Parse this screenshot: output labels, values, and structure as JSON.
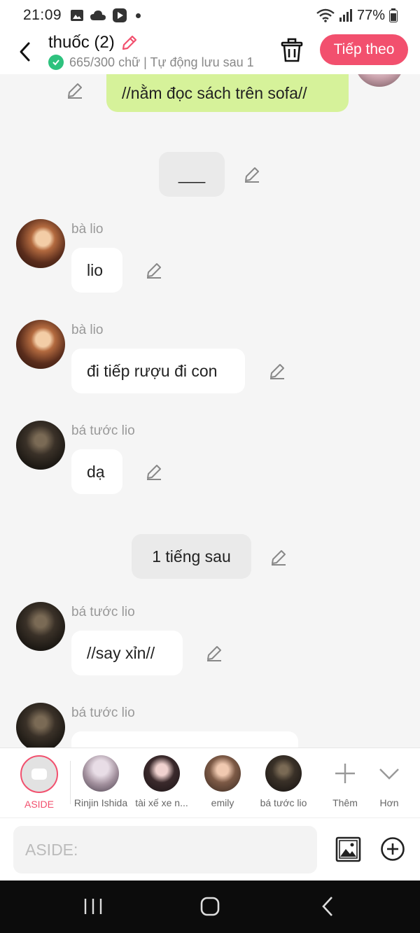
{
  "status": {
    "time": "21:09",
    "battery": "77%"
  },
  "header": {
    "title": "thuốc (2)",
    "subtitle": "665/300 chữ | Tự động lưu sau 1",
    "next_label": "Tiếp theo"
  },
  "messages": {
    "m1": {
      "text": "//nằm đọc sách trên sofa//"
    },
    "n1": {
      "text": "___"
    },
    "m2": {
      "sender": "bà lio",
      "text": "lio"
    },
    "m3": {
      "sender": "bà lio",
      "text": "đi tiếp rượu đi con"
    },
    "m4": {
      "sender": "bá tước lio",
      "text": "dạ"
    },
    "n2": {
      "text": "1 tiếng sau"
    },
    "m5": {
      "sender": "bá tước lio",
      "text": "//say xỉn//"
    },
    "m6": {
      "sender": "bá tước lio",
      "text": ""
    }
  },
  "characters": [
    {
      "label": "ASIDE"
    },
    {
      "label": "Rinjin Ishida"
    },
    {
      "label": "tài xế xe n..."
    },
    {
      "label": "emily"
    },
    {
      "label": "bá tước lio"
    },
    {
      "label": "Thêm"
    },
    {
      "label": "Hơn"
    }
  ],
  "input": {
    "placeholder": "ASIDE:"
  },
  "colors": {
    "accent": "#f2506e",
    "my_bubble": "#d6f29a",
    "saved_check": "#2ec27e"
  },
  "icons": [
    "back-arrow-icon",
    "pencil-icon",
    "trash-icon",
    "image-icon",
    "plus-circle-icon",
    "recents-icon",
    "home-icon",
    "back-nav-icon"
  ]
}
